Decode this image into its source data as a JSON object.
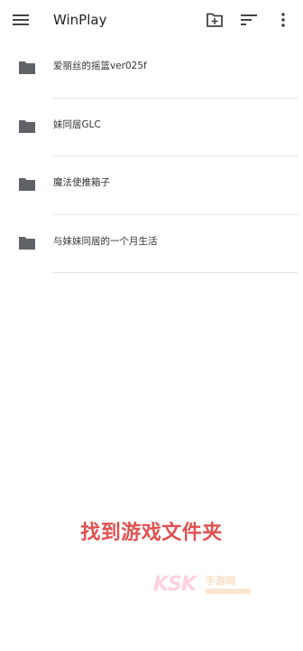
{
  "toolbar": {
    "title": "WinPlay",
    "menu_icon": "menu-icon",
    "new_folder_icon": "create-new-folder-icon",
    "sort_icon": "sort-icon",
    "more_icon": "more-vert-icon"
  },
  "folders": [
    {
      "name": "爱丽丝的摇篮ver025f",
      "icon": "folder-icon"
    },
    {
      "name": "妹同居GLC",
      "icon": "folder-icon"
    },
    {
      "name": "魔法使推箱子",
      "icon": "folder-icon"
    },
    {
      "name": "与妹妹同居的一个月生活",
      "icon": "folder-icon"
    }
  ],
  "annotation": {
    "text": "找到游戏文件夹",
    "color": "#e2504f"
  },
  "watermark": {
    "brand": "KSK",
    "sub": "手游网"
  },
  "colors": {
    "icon": "#5f6368",
    "divider": "#e3e3e3",
    "text": "#333333"
  }
}
